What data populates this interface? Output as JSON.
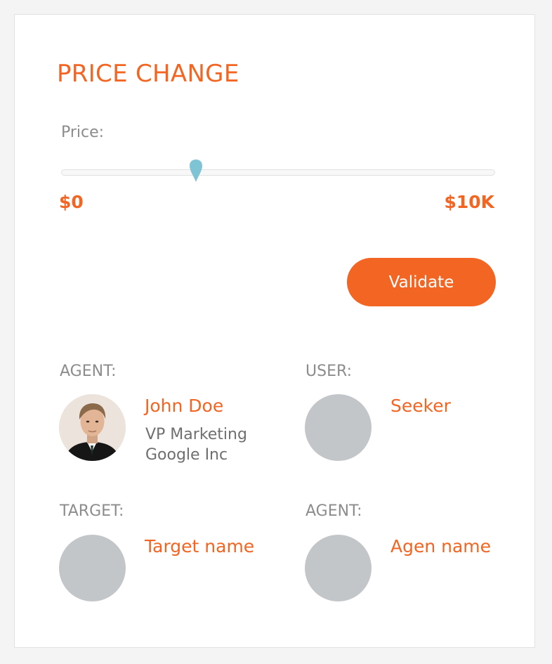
{
  "panel": {
    "title": "PRICE CHANGE"
  },
  "price": {
    "label": "Price:",
    "min_label": "$0",
    "max_label": "$10K",
    "slider_fraction": 0.31,
    "handle_color": "#7ec4d4"
  },
  "actions": {
    "validate_label": "Validate"
  },
  "people": {
    "agent": {
      "role": "AGENT:",
      "name": "John Doe",
      "title": "VP Marketing",
      "company": "Google Inc"
    },
    "user": {
      "role": "USER:",
      "name": "Seeker"
    },
    "target": {
      "role": "TARGET:",
      "name": "Target name"
    },
    "agent2": {
      "role": "AGENT:",
      "name": "Agen name"
    }
  },
  "colors": {
    "accent": "#f26522",
    "label_gray": "#8c8c8c",
    "avatar_placeholder": "#c3c6c9"
  }
}
